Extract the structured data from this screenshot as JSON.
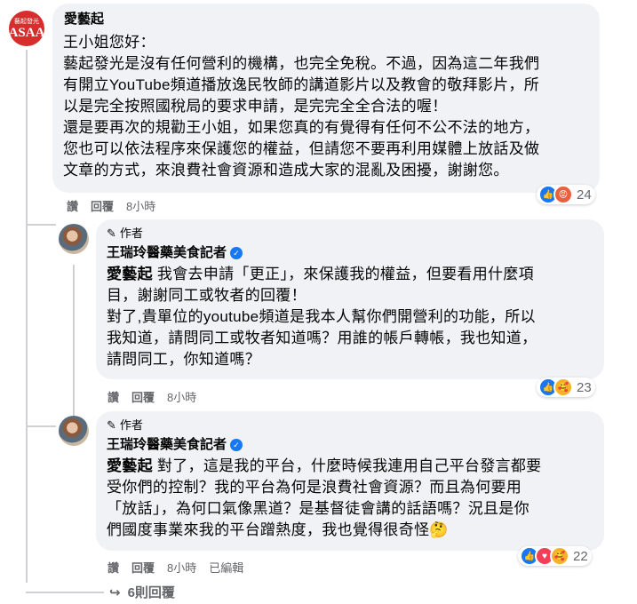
{
  "comments": [
    {
      "author": "愛藝起",
      "avatar_logo_top": "藝起發光",
      "avatar_logo_main": "ASAA",
      "lines": [
        "王小姐您好：",
        "藝起發光是沒有任何營利的機構，也完全免稅。不過，因為這二年我們",
        "有開立YouTube頻道播放逸民牧師的講道影片以及教會的敬拜影片，所",
        "以是完全按照國稅局的要求申請，是完完全全合法的喔！",
        "還是要再次的規勸王小姐，如果您真的有覺得有任何不公不法的地方，",
        "您也可以依法程序來保護您的權益，但請您不要再利用媒體上放話及做",
        "文章的方式，來浪費社會資源和造成大家的混亂及困擾，謝謝您。"
      ],
      "actions": {
        "like": "讚",
        "reply": "回覆",
        "time": "8小時"
      },
      "reaction_count": "24"
    },
    {
      "author_tag": "作者",
      "author": "王瑞玲醫藥美食記者",
      "mention": "愛藝起",
      "lines": [
        " 我會去申請「更正」，來保護我的權益，但要看用什麼項",
        "目，謝謝同工或牧者的回覆！",
        "對了,貴單位的youtube頻道是我本人幫你們開營利的功能，所以",
        "我知道，請問同工或牧者知道嗎？用誰的帳戶轉帳，我也知道，",
        "請問同工，你知道嗎？"
      ],
      "actions": {
        "like": "讚",
        "reply": "回覆",
        "time": "8小時"
      },
      "reaction_count": "23"
    },
    {
      "author_tag": "作者",
      "author": "王瑞玲醫藥美食記者",
      "mention": "愛藝起",
      "lines": [
        " 對了，這是我的平台，什麼時候我連用自己平台發言都要",
        "受你們的控制？我的平台為何是浪費社會資源？而且為何要用",
        "「放話」，為何口氣像黑道？是基督徒會講的話語嗎？況且是你",
        "們國度事業來我的平台蹭熱度，我也覺得很奇怪"
      ],
      "trailing_emoji": "🤔",
      "actions": {
        "like": "讚",
        "reply": "回覆",
        "time": "8小時",
        "edited": "已編輯"
      },
      "reaction_count": "22"
    }
  ],
  "view_replies": "6則回覆",
  "icons": {
    "pencil": "✎",
    "verified": "✓",
    "reply_arrow": "↪",
    "like": "👍",
    "angry": "😡",
    "care": "🥰",
    "love": "♥"
  },
  "colors": {
    "bubble": "#f0f2f5",
    "meta": "#65676b",
    "accent": "#1877f2"
  }
}
